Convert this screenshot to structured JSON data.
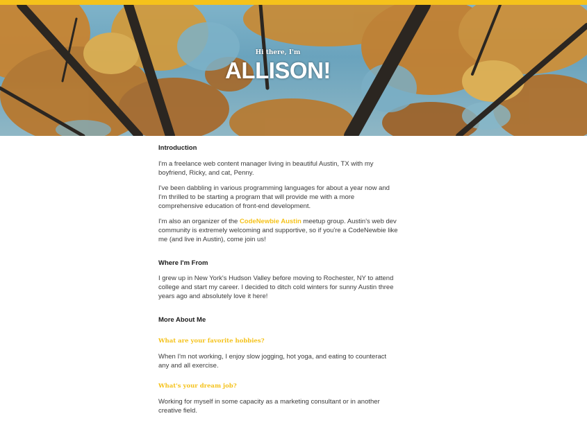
{
  "colors": {
    "accent": "#f5c21b",
    "text": "#3a3a3a",
    "heading": "#1a1a1a"
  },
  "hero": {
    "greeting": "Hi there, I'm",
    "name": "ALLISON!"
  },
  "intro": {
    "heading": "Introduction",
    "p1": "I'm a freelance web content manager living in beautiful Austin, TX with my boyfriend, Ricky, and cat, Penny.",
    "p2": "I've been dabbling in various programming languages for about a year now and I'm thrilled to be starting a program that will provide me with a more comprehensive education of front-end development.",
    "p3_before": "I'm also an organizer of the ",
    "p3_link": "CodeNewbie Austin",
    "p3_after": " meetup group. Austin's web dev community is extremely welcoming and supportive, so if you're a CodeNewbie like me (and live in Austin), come join us!"
  },
  "from": {
    "heading": "Where I'm From",
    "p1": "I grew up in New York's Hudson Valley before moving to Rochester, NY to attend college and start my career. I decided to ditch cold winters for sunny Austin three years ago and absolutely love it here!"
  },
  "more": {
    "heading": "More About Me",
    "q1": "What are your favorite hobbies?",
    "a1": "When I'm not working, I enjoy slow jogging, hot yoga, and eating to counteract any and all exercise.",
    "q2": "What's your dream job?",
    "a2": "Working for myself in some capacity as a marketing consultant or in another creative field."
  }
}
